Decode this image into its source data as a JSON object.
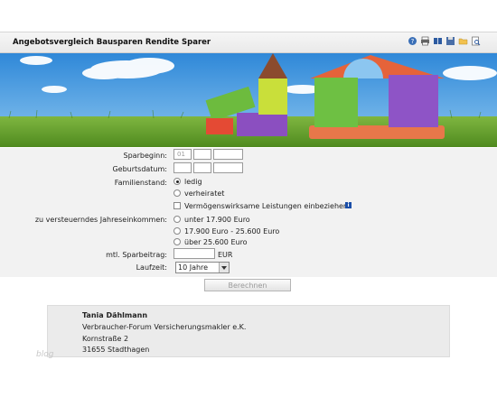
{
  "header": {
    "title": "Angebotsvergleich Bausparen Rendite Sparer",
    "tools": [
      "help-icon",
      "print-icon",
      "book-icon",
      "save-icon",
      "folder-icon",
      "preview-icon"
    ]
  },
  "form": {
    "sparbeginn_label": "Sparbeginn:",
    "sparbeginn_day": "01",
    "geburtsdatum_label": "Geburtsdatum:",
    "familienstand_label": "Familienstand:",
    "opt_ledig": "ledig",
    "opt_verheiratet": "verheiratet",
    "vwl_label": "Vermögenswirksame Leistungen einbeziehen",
    "einkommen_label": "zu versteuerndes Jahreseinkommen:",
    "opt_e1": "unter 17.900 Euro",
    "opt_e2": "17.900 Euro - 25.600 Euro",
    "opt_e3": "über 25.600 Euro",
    "sparbeitrag_label": "mtl. Sparbeitrag:",
    "currency": "EUR",
    "laufzeit_label": "Laufzeit:",
    "laufzeit_value": "10 Jahre"
  },
  "submit_label": "Berechnen",
  "contact": {
    "name": "Tania Dählmann",
    "company": "Verbraucher-Forum Versicherungsmakler e.K.",
    "street": "Kornstraße 2",
    "city": "31655 Stadthagen"
  },
  "watermark": "blog"
}
